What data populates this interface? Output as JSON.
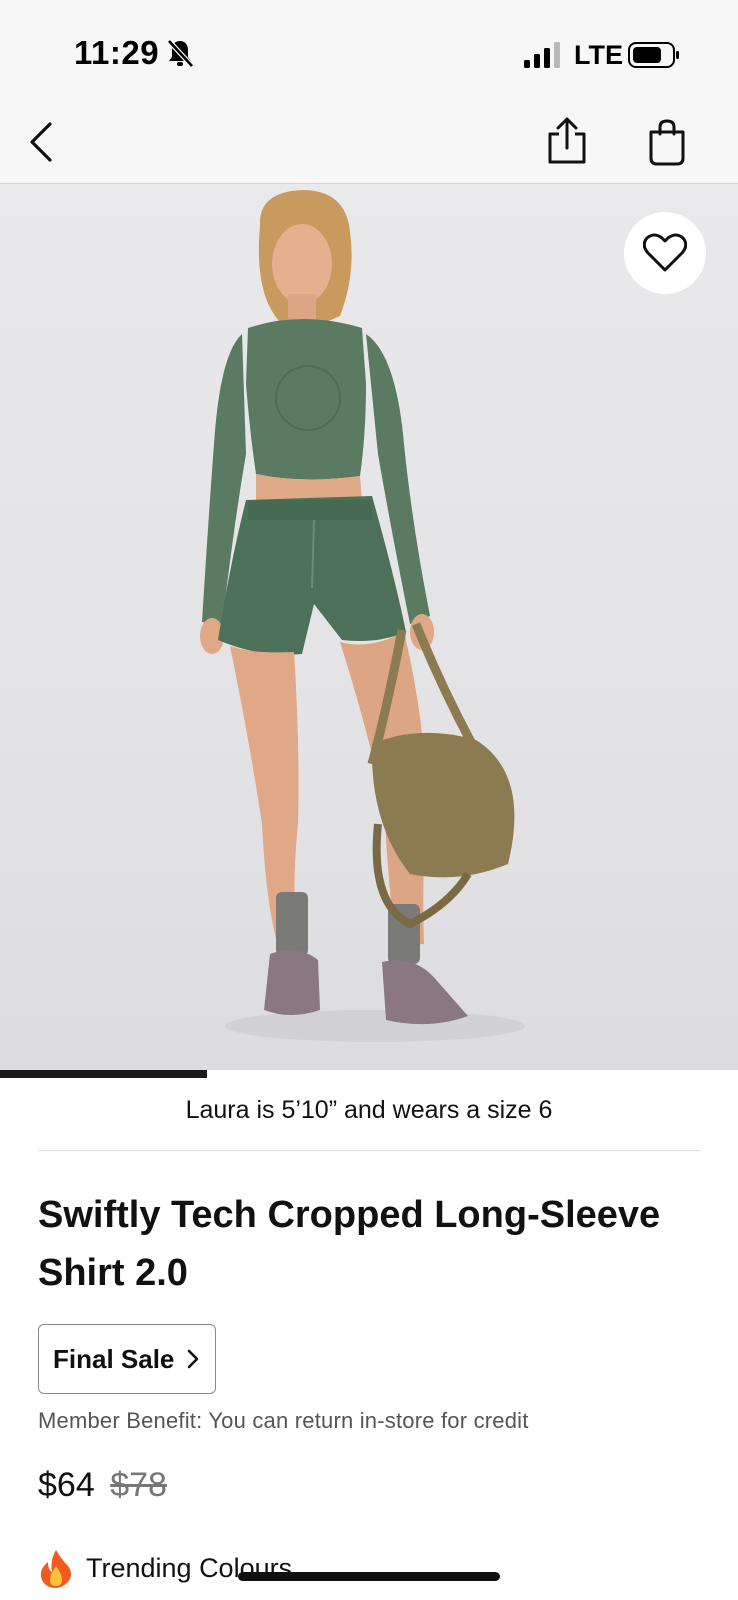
{
  "status_bar": {
    "time": "11:29",
    "network": "LTE",
    "icons": [
      "bell-off-icon",
      "signal-icon",
      "battery-icon"
    ]
  },
  "nav": {
    "icons": [
      "chevron-left-icon",
      "share-icon",
      "shopping-bag-icon"
    ]
  },
  "hero": {
    "gallery_progress": 0.28,
    "favorite_icon": "heart-icon"
  },
  "model_info": "Laura is 5’10” and wears a size 6",
  "product": {
    "title": "Swiftly Tech Cropped Long-Sleeve Shirt 2.0",
    "final_sale_label": "Final Sale",
    "member_benefit": "Member Benefit: You can return in-store for credit",
    "price_sale": "$64",
    "price_original": "$78"
  },
  "trending": {
    "label": "Trending Colours",
    "icon": "fire-icon"
  },
  "colors": {
    "shirt": "#5b7a62",
    "shorts": "#4d7058",
    "bag": "#8c7a50",
    "text": "#111111",
    "muted": "#555555"
  }
}
